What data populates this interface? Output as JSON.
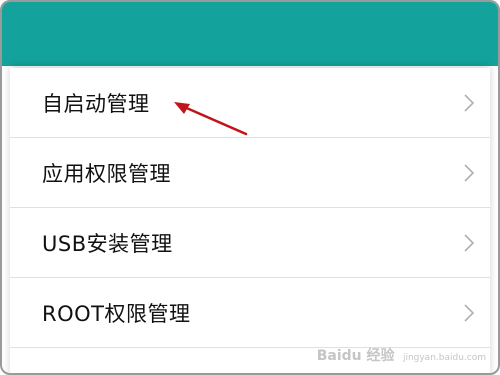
{
  "menu": {
    "items": [
      {
        "label": "自启动管理",
        "chevron_icon": "chevron-right-icon"
      },
      {
        "label": "应用权限管理",
        "chevron_icon": "chevron-right-icon"
      },
      {
        "label": "USB安装管理",
        "chevron_icon": "chevron-right-icon"
      },
      {
        "label": "ROOT权限管理",
        "chevron_icon": "chevron-right-icon"
      }
    ]
  },
  "colors": {
    "header": "#14a39c",
    "annotation_arrow": "#c0141a",
    "chevron": "#b0b0b0"
  },
  "watermark": {
    "text": "Baidu 经验",
    "url": "jingyan.baidu.com"
  }
}
